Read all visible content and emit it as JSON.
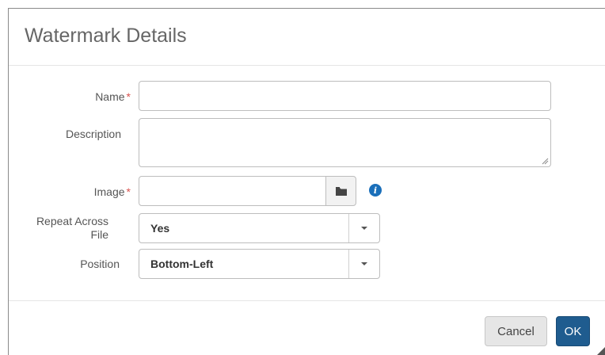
{
  "dialog": {
    "title": "Watermark Details"
  },
  "form": {
    "name": {
      "label": "Name",
      "required_mark": "*",
      "value": ""
    },
    "description": {
      "label": "Description",
      "value": ""
    },
    "image": {
      "label": "Image",
      "required_mark": "*",
      "value": "",
      "browse_icon": "folder-icon",
      "info_icon": "info-icon",
      "info_glyph": "i"
    },
    "repeat_across_file": {
      "label_line1": "Repeat Across",
      "label_line2": "File",
      "selected": "Yes"
    },
    "position": {
      "label": "Position",
      "selected": "Bottom-Left"
    }
  },
  "footer": {
    "cancel_label": "Cancel",
    "ok_label": "OK"
  },
  "colors": {
    "primary": "#1f5c8f",
    "required": "#d9534f",
    "info": "#1a6fba"
  }
}
